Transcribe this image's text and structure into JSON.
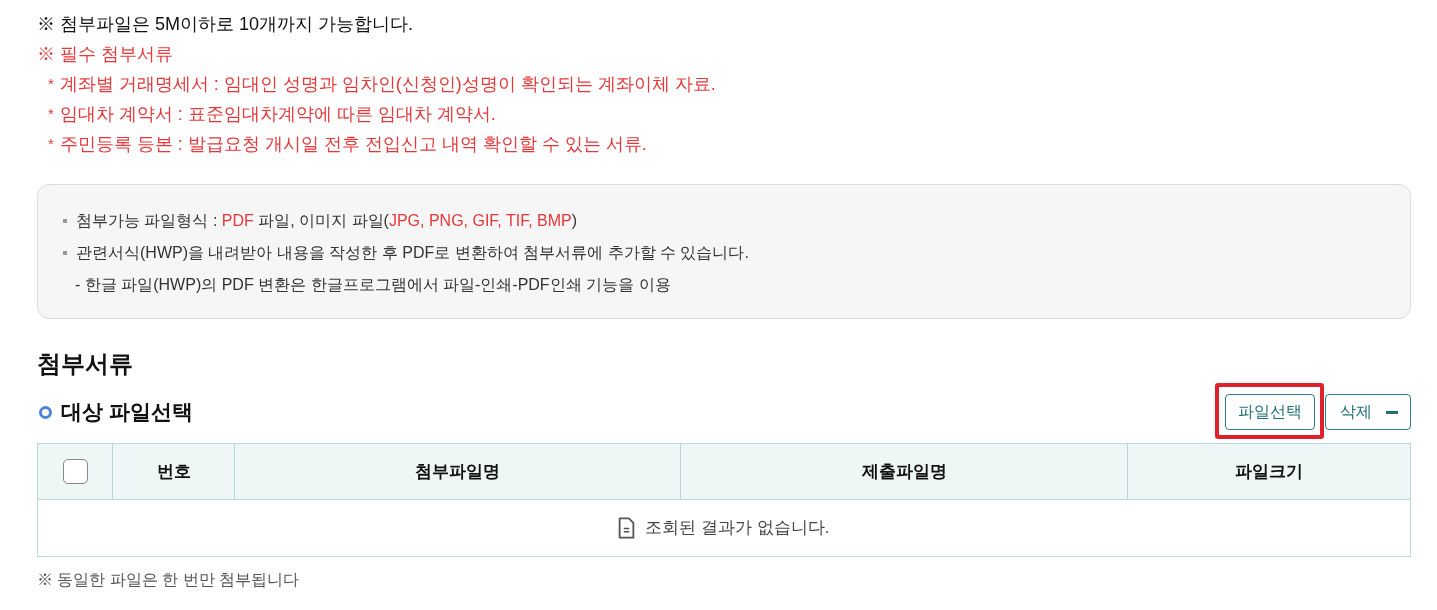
{
  "notice": {
    "text": "※ 첨부파일은 5M이하로 10개까지 가능합니다."
  },
  "required_docs": {
    "title": "※ 필수 첨부서류",
    "items": [
      {
        "marker": "*",
        "text": "계좌별 거래명세서 : 임대인 성명과 임차인(신청인)성명이 확인되는 계좌이체 자료."
      },
      {
        "marker": "*",
        "text": "임대차 계약서 : 표준임대차계약에 따른 임대차 계약서."
      },
      {
        "marker": "*",
        "text": "주민등록 등본 : 발급요청 개시일 전후 전입신고 내역 확인할 수 있는 서류."
      }
    ]
  },
  "info_box": {
    "items": [
      {
        "kind": "bullet",
        "segments": [
          {
            "text": "첨부가능 파일형식 : ",
            "highlight": false
          },
          {
            "text": "PDF",
            "highlight": true
          },
          {
            "text": " 파일, 이미지 파일(",
            "highlight": false
          },
          {
            "text": "JPG, PNG, GIF, TIF, BMP",
            "highlight": true
          },
          {
            "text": ")",
            "highlight": false
          }
        ]
      },
      {
        "kind": "bullet",
        "segments": [
          {
            "text": "관련서식(HWP)을 내려받아 내용을 작성한 후 PDF로 변환하여 첨부서류에 추가할 수 있습니다.",
            "highlight": false
          }
        ]
      },
      {
        "kind": "sub",
        "segments": [
          {
            "text": "- 한글 파일(HWP)의 PDF 변환은 한글프로그램에서 파일-인쇄-PDF인쇄 기능을 이용",
            "highlight": false
          }
        ]
      }
    ]
  },
  "section": {
    "title": "첨부서류",
    "subtitle": "대상 파일선택",
    "buttons": [
      {
        "kind": "text",
        "label": "파일선택",
        "highlighted": true
      },
      {
        "kind": "minus",
        "label": "삭제",
        "highlighted": false
      }
    ]
  },
  "table": {
    "select_all": {
      "checked": false
    },
    "columns": [
      "번호",
      "첨부파일명",
      "제출파일명",
      "파일크기"
    ],
    "empty_message": "조회된 결과가 없습니다."
  },
  "footnote": {
    "text": "※ 동일한 파일은 한 번만 첨부됩니다"
  }
}
